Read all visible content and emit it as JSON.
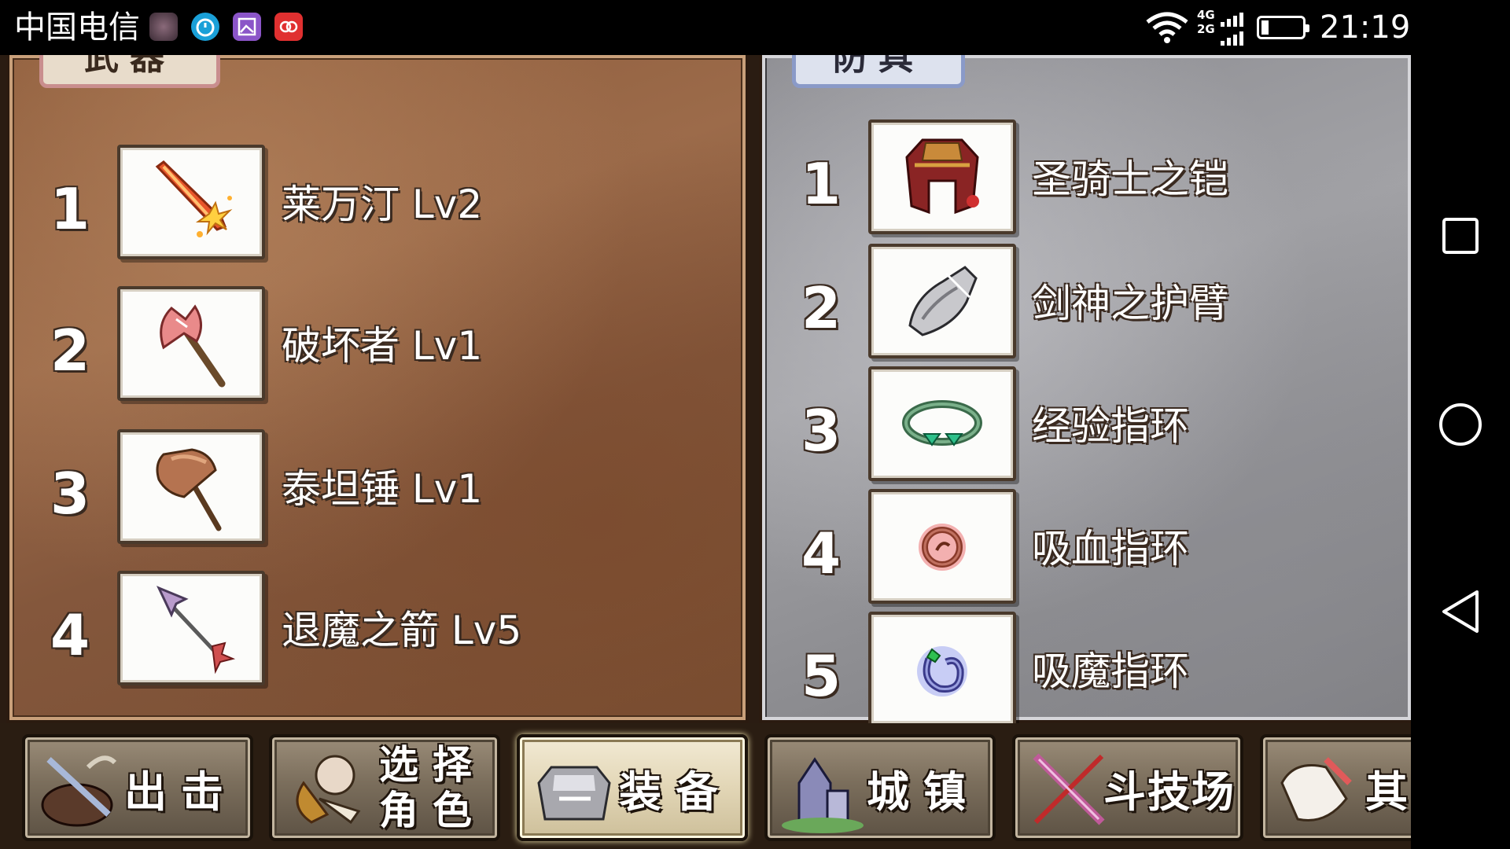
{
  "status_bar": {
    "carrier": "中国电信",
    "network_top": "4G",
    "network_bottom": "2G",
    "time": "21:19"
  },
  "nav_bar": {
    "buttons": [
      "recents-square-icon",
      "home-circle-icon",
      "back-triangle-icon"
    ]
  },
  "weapons_panel": {
    "tab_label": "武器",
    "items": [
      {
        "index": "1",
        "name": "莱万汀 Lv2",
        "icon": "flame-sword-icon"
      },
      {
        "index": "2",
        "name": "破坏者 Lv1",
        "icon": "battle-axe-icon"
      },
      {
        "index": "3",
        "name": "泰坦锤 Lv1",
        "icon": "wooden-hammer-icon"
      },
      {
        "index": "4",
        "name": "退魔之箭 Lv5",
        "icon": "arrow-icon"
      }
    ]
  },
  "armor_panel": {
    "tab_label": "防具",
    "items": [
      {
        "index": "1",
        "name": "圣骑士之铠",
        "icon": "paladin-armor-icon"
      },
      {
        "index": "2",
        "name": "剑神之护臂",
        "icon": "gauntlet-icon"
      },
      {
        "index": "3",
        "name": "经验指环",
        "icon": "green-ring-icon"
      },
      {
        "index": "4",
        "name": "吸血指环",
        "icon": "red-ring-icon"
      },
      {
        "index": "5",
        "name": "吸魔指环",
        "icon": "blue-ring-icon"
      }
    ]
  },
  "bottom_menu": {
    "active": "装备",
    "buttons": [
      {
        "label": "出击",
        "icon": "sortie-icon"
      },
      {
        "label_line1": "选择",
        "label_line2": "角色",
        "icon": "character-select-icon"
      },
      {
        "label": "装备",
        "icon": "equipment-icon"
      },
      {
        "label": "城镇",
        "icon": "town-icon"
      },
      {
        "label": "斗技场",
        "icon": "arena-icon"
      },
      {
        "label": "其",
        "icon": "other-icon"
      }
    ]
  },
  "colors": {
    "weapons_panel_bg": "#8b5a3a",
    "armor_panel_bg": "#9a9a9e",
    "menu_button_active": "#e2d6b6"
  }
}
